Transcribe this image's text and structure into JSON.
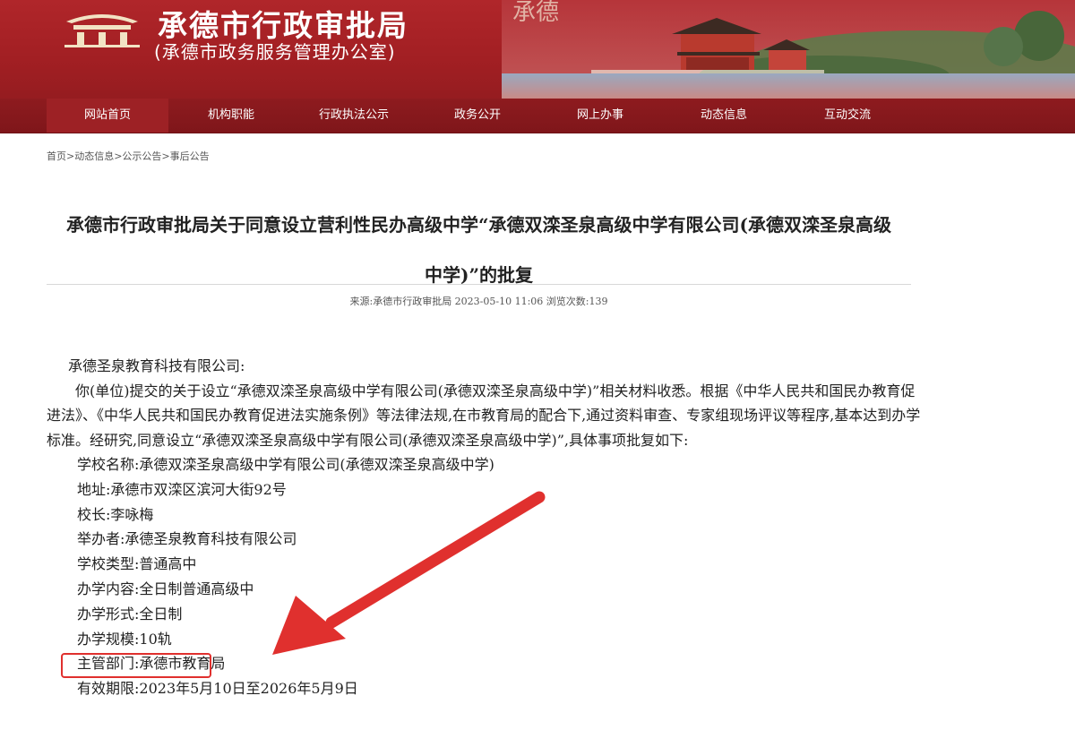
{
  "header": {
    "title": "承德市行政审批局",
    "subtitle": "(承德市政务服务管理办公室)",
    "seal_text": "承德"
  },
  "nav": {
    "items": [
      {
        "label": "网站首页",
        "active": true
      },
      {
        "label": "机构职能"
      },
      {
        "label": "行政执法公示"
      },
      {
        "label": "政务公开"
      },
      {
        "label": "网上办事"
      },
      {
        "label": "动态信息"
      },
      {
        "label": "互动交流"
      }
    ]
  },
  "breadcrumb": "首页>动态信息>公示公告>事后公告",
  "article": {
    "title_line1": "承德市行政审批局关于同意设立营利性民办高级中学“承德双滦圣泉高级中学有限公司(承德双滦圣泉高级",
    "title_line2": "中学)”的批复",
    "meta": "来源:承德市行政审批局 2023-05-10 11:06 浏览次数:139",
    "addressee": "承德圣泉教育科技有限公司:",
    "paragraph": "你(单位)提交的关于设立“承德双滦圣泉高级中学有限公司(承德双滦圣泉高级中学)”相关材料收悉。根据《中华人民共和国民办教育促进法》、《中华人民共和国民办教育促进法实施条例》等法律法规,在市教育局的配合下,通过资料审查、专家组现场评议等程序,基本达到办学标准。经研究,同意设立“承德双滦圣泉高级中学有限公司(承德双滦圣泉高级中学)”,具体事项批复如下:",
    "items": [
      {
        "label": "学校名称:",
        "value": "承德双滦圣泉高级中学有限公司(承德双滦圣泉高级中学)"
      },
      {
        "label": "地址:",
        "value": "承德市双滦区滨河大街92号"
      },
      {
        "label": "校长:",
        "value": "李咏梅"
      },
      {
        "label": "举办者:",
        "value": "承德圣泉教育科技有限公司"
      },
      {
        "label": "学校类型:",
        "value": "普通高中"
      },
      {
        "label": "办学内容:",
        "value": "全日制普通高级中"
      },
      {
        "label": "办学形式:",
        "value": "全日制"
      },
      {
        "label": "办学规模:",
        "value": "10轨"
      },
      {
        "label": "主管部门:",
        "value": "承德市教育局"
      },
      {
        "label": "有效期限:",
        "value": "2023年5月10日至2026年5月9日"
      }
    ]
  },
  "colors": {
    "banner": "#a21f23",
    "nav": "#861a1e",
    "annotation": "#e0302e"
  }
}
